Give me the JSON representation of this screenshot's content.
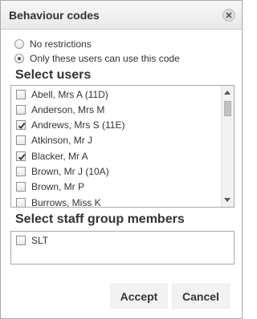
{
  "dialog": {
    "title": "Behaviour codes",
    "close_icon": "close-circle-icon"
  },
  "access": {
    "options": [
      {
        "label": "No restrictions",
        "selected": false
      },
      {
        "label": "Only these users can use this code",
        "selected": true
      }
    ]
  },
  "select_users": {
    "heading": "Select users",
    "items": [
      {
        "label": "Abell, Mrs A (11D)",
        "checked": false
      },
      {
        "label": "Anderson, Mrs M",
        "checked": false
      },
      {
        "label": "Andrews, Mrs S (11E)",
        "checked": true
      },
      {
        "label": "Atkinson, Mr J",
        "checked": false
      },
      {
        "label": "Blacker, Mr A",
        "checked": true
      },
      {
        "label": "Brown, Mr J (10A)",
        "checked": false
      },
      {
        "label": "Brown, Mr P",
        "checked": false
      },
      {
        "label": "Burrows, Miss K",
        "checked": false
      }
    ]
  },
  "staff_groups": {
    "heading": "Select staff group members",
    "items": [
      {
        "label": "SLT",
        "checked": false
      }
    ]
  },
  "buttons": {
    "accept": "Accept",
    "cancel": "Cancel"
  }
}
